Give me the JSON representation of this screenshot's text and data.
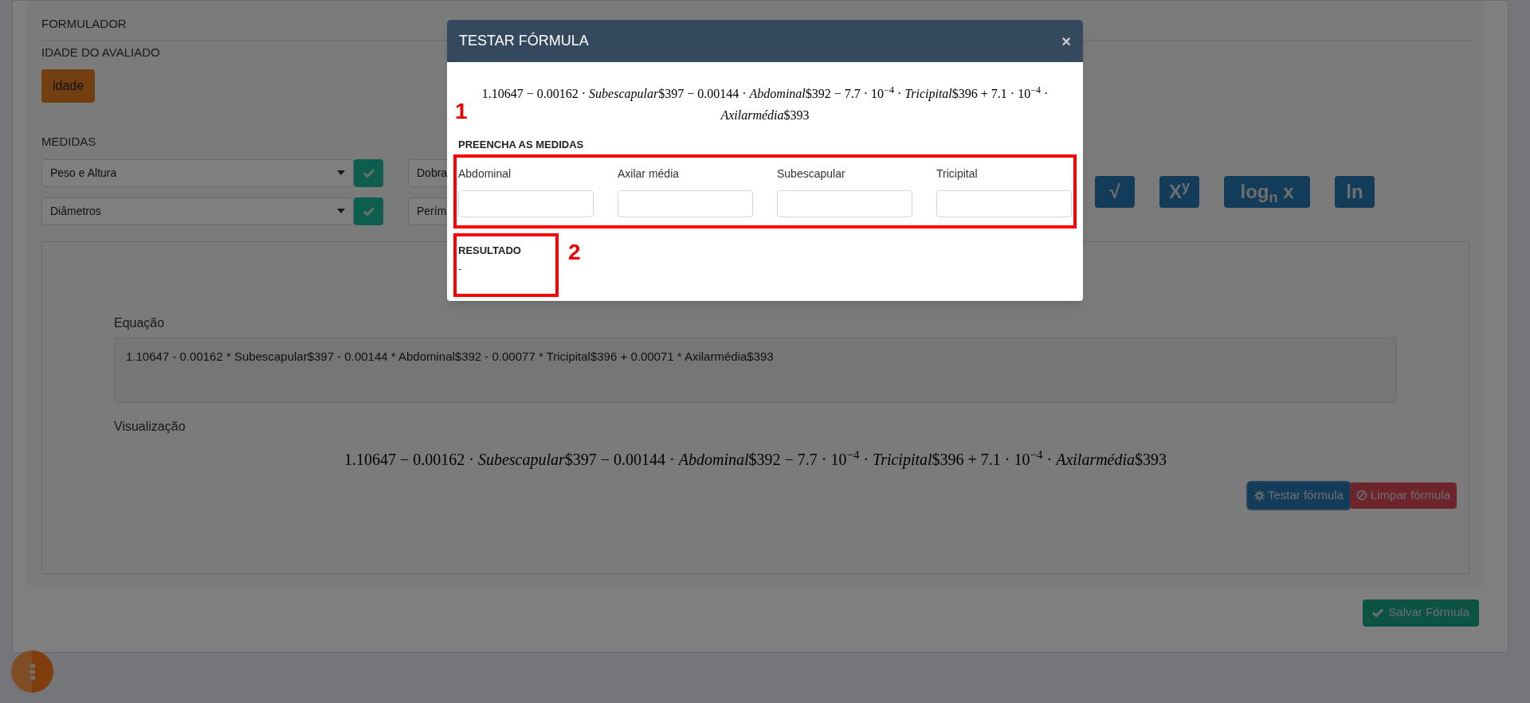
{
  "background": {
    "section_title": "FORMULADOR",
    "age": {
      "label": "IDADE DO AVALIADO",
      "button": "idade"
    },
    "measures": {
      "label": "MEDIDAS",
      "selects": [
        {
          "value": "Peso e Altura"
        },
        {
          "value": "Dobra"
        },
        {
          "value": "Diâmetros"
        },
        {
          "value": "Perím"
        }
      ]
    },
    "function_buttons": [
      {
        "label": "√"
      },
      {
        "label": "X$^{y}$"
      },
      {
        "label": "log$_{n}$ x"
      },
      {
        "label": "ln"
      }
    ],
    "equation": {
      "label": "Equação",
      "value": "1.10647 - 0.00162 * Subescapular$397 - 0.00144 * Abdominal$392 - 0.00077 * Tricipital$396 + 0.00071 * Axilarmédia$393"
    },
    "preview": {
      "label": "Visualização",
      "formula": "1.10647 − 0.00162 · *Subescapular*$397 − 0.00144 · *Abdominal*$392 − 7.7 · 10$^{−4}$ · *Tricipital*$396 + 7.1 · 10$^{−4}$ · *Axilarmédia*$393"
    },
    "actions": [
      {
        "label": "Testar fórmula",
        "kind": "test"
      },
      {
        "label": "Limpar fórmula",
        "kind": "clear"
      }
    ],
    "save_button": "Salvar Fórmula"
  },
  "modal": {
    "title": "TESTAR FÓRMULA",
    "close": "×",
    "formula": "1.10647 − 0.00162 · *Subescapular*$397 − 0.00144 · *Abdominal*$392 − 7.7 · 10$^{−4}$ · *Tricipital*$396 + 7.1 · 10$^{−4}$ · *Axilarmédia*$393",
    "fields_title": "PREENCHA AS MEDIDAS",
    "fields": [
      {
        "label": "Abdominal"
      },
      {
        "label": "Axilar média"
      },
      {
        "label": "Subescapular"
      },
      {
        "label": "Tricipital"
      }
    ],
    "result": {
      "label": "RESULTADO",
      "value": "-"
    }
  },
  "annotations": [
    {
      "label": "1"
    },
    {
      "label": "2"
    }
  ]
}
